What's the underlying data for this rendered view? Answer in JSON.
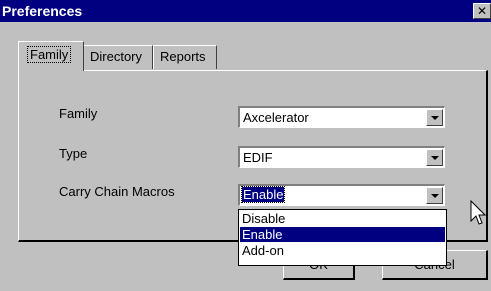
{
  "window": {
    "title": "Preferences",
    "close_glyph": "✕"
  },
  "tabs": [
    {
      "label": "Family",
      "active": true
    },
    {
      "label": "Directory",
      "active": false
    },
    {
      "label": "Reports",
      "active": false
    }
  ],
  "fields": {
    "family": {
      "label": "Family",
      "value": "Axcelerator"
    },
    "type": {
      "label": "Type",
      "value": "EDIF"
    },
    "carry_chain": {
      "label": "Carry Chain Macros",
      "value": "Enable"
    }
  },
  "dropdown": {
    "options": [
      "Disable",
      "Enable",
      "Add-on"
    ],
    "highlighted": "Enable"
  },
  "buttons": {
    "ok": "OK",
    "cancel": "Cancel"
  },
  "colors": {
    "title_bar": "#000080",
    "face": "#c0c0c0",
    "selection": "#000080"
  }
}
